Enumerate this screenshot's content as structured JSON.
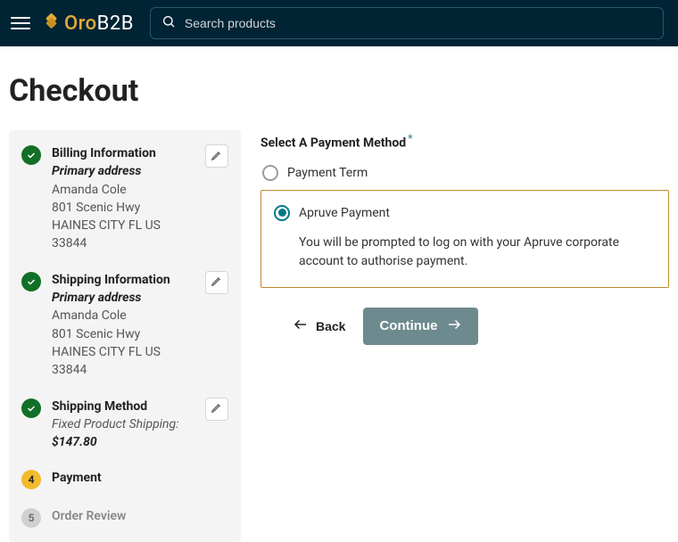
{
  "header": {
    "logo_oro": "Oro",
    "logo_b2b": "B2B",
    "search_placeholder": "Search products"
  },
  "page": {
    "title": "Checkout"
  },
  "steps": {
    "billing": {
      "title": "Billing Information",
      "subtitle": "Primary address",
      "line1": "Amanda Cole",
      "line2": "801 Scenic Hwy",
      "line3": "HAINES CITY FL US 33844"
    },
    "shipping_info": {
      "title": "Shipping Information",
      "subtitle": "Primary address",
      "line1": "Amanda Cole",
      "line2": "801 Scenic Hwy",
      "line3": "HAINES CITY FL US 33844"
    },
    "shipping_method": {
      "title": "Shipping Method",
      "subtitle": "Fixed Product Shipping:",
      "price": "$147.80"
    },
    "payment": {
      "number": "4",
      "title": "Payment"
    },
    "review": {
      "number": "5",
      "title": "Order Review"
    }
  },
  "main": {
    "section_label": "Select A Payment Method",
    "options": {
      "term": "Payment Term",
      "apruve": "Apruve Payment"
    },
    "apruve_hint": "You will be prompted to log on with your Apruve corporate account to authorise payment.",
    "back_label": "Back",
    "continue_label": "Continue"
  }
}
